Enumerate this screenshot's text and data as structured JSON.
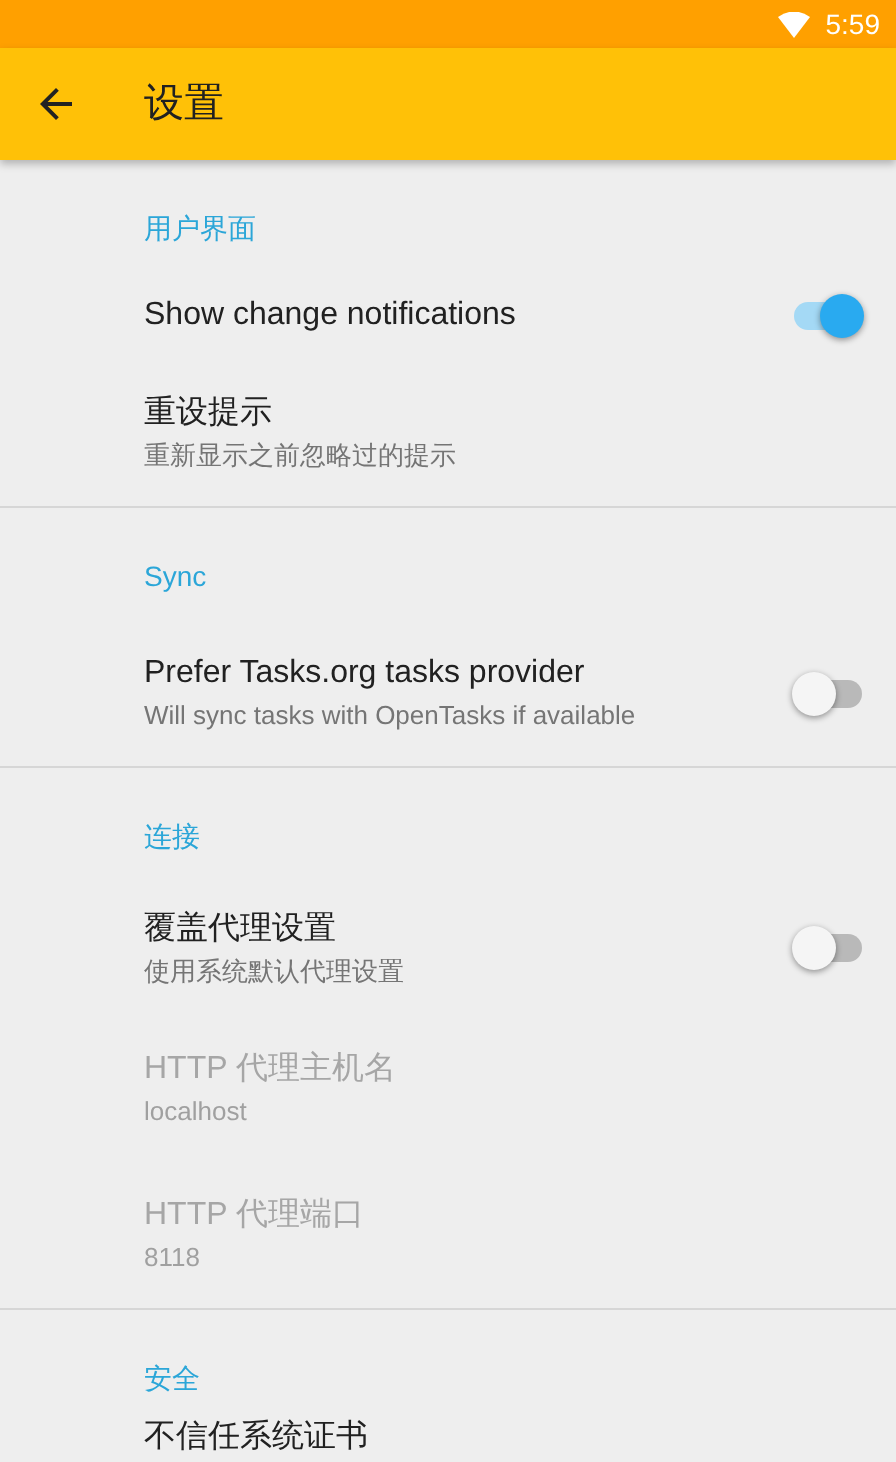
{
  "status_bar": {
    "time": "5:59"
  },
  "toolbar": {
    "title": "设置"
  },
  "sections": [
    {
      "header": "用户界面",
      "items": [
        {
          "kind": "switch",
          "title": "Show change notifications",
          "on": true,
          "disabled": false
        },
        {
          "kind": "text",
          "title": "重设提示",
          "summary": "重新显示之前忽略过的提示",
          "disabled": false
        }
      ]
    },
    {
      "header": "Sync",
      "items": [
        {
          "kind": "switch",
          "title": "Prefer Tasks.org tasks provider",
          "summary": "Will sync tasks with OpenTasks if available",
          "on": false,
          "disabled": false
        }
      ]
    },
    {
      "header": "连接",
      "items": [
        {
          "kind": "switch",
          "title": "覆盖代理设置",
          "summary": "使用系统默认代理设置",
          "on": false,
          "disabled": false
        },
        {
          "kind": "text",
          "title": "HTTP 代理主机名",
          "summary": "localhost",
          "disabled": true
        },
        {
          "kind": "text",
          "title": "HTTP 代理端口",
          "summary": "8118",
          "disabled": true
        }
      ]
    },
    {
      "header": "安全",
      "items": [
        {
          "kind": "text",
          "title": "不信任系统证书",
          "disabled": false
        }
      ]
    }
  ]
}
